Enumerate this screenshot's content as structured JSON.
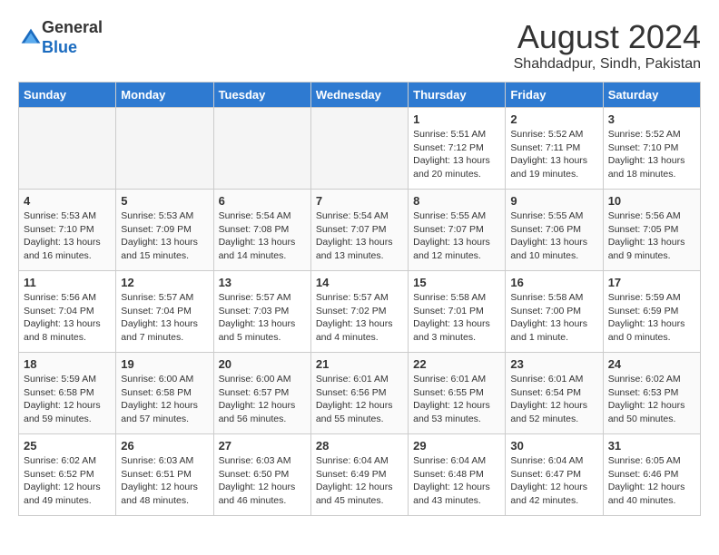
{
  "header": {
    "logo_line1": "General",
    "logo_line2": "Blue",
    "month_year": "August 2024",
    "location": "Shahdadpur, Sindh, Pakistan"
  },
  "days_of_week": [
    "Sunday",
    "Monday",
    "Tuesday",
    "Wednesday",
    "Thursday",
    "Friday",
    "Saturday"
  ],
  "weeks": [
    [
      {
        "day": "",
        "info": ""
      },
      {
        "day": "",
        "info": ""
      },
      {
        "day": "",
        "info": ""
      },
      {
        "day": "",
        "info": ""
      },
      {
        "day": "1",
        "info": "Sunrise: 5:51 AM\nSunset: 7:12 PM\nDaylight: 13 hours\nand 20 minutes."
      },
      {
        "day": "2",
        "info": "Sunrise: 5:52 AM\nSunset: 7:11 PM\nDaylight: 13 hours\nand 19 minutes."
      },
      {
        "day": "3",
        "info": "Sunrise: 5:52 AM\nSunset: 7:10 PM\nDaylight: 13 hours\nand 18 minutes."
      }
    ],
    [
      {
        "day": "4",
        "info": "Sunrise: 5:53 AM\nSunset: 7:10 PM\nDaylight: 13 hours\nand 16 minutes."
      },
      {
        "day": "5",
        "info": "Sunrise: 5:53 AM\nSunset: 7:09 PM\nDaylight: 13 hours\nand 15 minutes."
      },
      {
        "day": "6",
        "info": "Sunrise: 5:54 AM\nSunset: 7:08 PM\nDaylight: 13 hours\nand 14 minutes."
      },
      {
        "day": "7",
        "info": "Sunrise: 5:54 AM\nSunset: 7:07 PM\nDaylight: 13 hours\nand 13 minutes."
      },
      {
        "day": "8",
        "info": "Sunrise: 5:55 AM\nSunset: 7:07 PM\nDaylight: 13 hours\nand 12 minutes."
      },
      {
        "day": "9",
        "info": "Sunrise: 5:55 AM\nSunset: 7:06 PM\nDaylight: 13 hours\nand 10 minutes."
      },
      {
        "day": "10",
        "info": "Sunrise: 5:56 AM\nSunset: 7:05 PM\nDaylight: 13 hours\nand 9 minutes."
      }
    ],
    [
      {
        "day": "11",
        "info": "Sunrise: 5:56 AM\nSunset: 7:04 PM\nDaylight: 13 hours\nand 8 minutes."
      },
      {
        "day": "12",
        "info": "Sunrise: 5:57 AM\nSunset: 7:04 PM\nDaylight: 13 hours\nand 7 minutes."
      },
      {
        "day": "13",
        "info": "Sunrise: 5:57 AM\nSunset: 7:03 PM\nDaylight: 13 hours\nand 5 minutes."
      },
      {
        "day": "14",
        "info": "Sunrise: 5:57 AM\nSunset: 7:02 PM\nDaylight: 13 hours\nand 4 minutes."
      },
      {
        "day": "15",
        "info": "Sunrise: 5:58 AM\nSunset: 7:01 PM\nDaylight: 13 hours\nand 3 minutes."
      },
      {
        "day": "16",
        "info": "Sunrise: 5:58 AM\nSunset: 7:00 PM\nDaylight: 13 hours\nand 1 minute."
      },
      {
        "day": "17",
        "info": "Sunrise: 5:59 AM\nSunset: 6:59 PM\nDaylight: 13 hours\nand 0 minutes."
      }
    ],
    [
      {
        "day": "18",
        "info": "Sunrise: 5:59 AM\nSunset: 6:58 PM\nDaylight: 12 hours\nand 59 minutes."
      },
      {
        "day": "19",
        "info": "Sunrise: 6:00 AM\nSunset: 6:58 PM\nDaylight: 12 hours\nand 57 minutes."
      },
      {
        "day": "20",
        "info": "Sunrise: 6:00 AM\nSunset: 6:57 PM\nDaylight: 12 hours\nand 56 minutes."
      },
      {
        "day": "21",
        "info": "Sunrise: 6:01 AM\nSunset: 6:56 PM\nDaylight: 12 hours\nand 55 minutes."
      },
      {
        "day": "22",
        "info": "Sunrise: 6:01 AM\nSunset: 6:55 PM\nDaylight: 12 hours\nand 53 minutes."
      },
      {
        "day": "23",
        "info": "Sunrise: 6:01 AM\nSunset: 6:54 PM\nDaylight: 12 hours\nand 52 minutes."
      },
      {
        "day": "24",
        "info": "Sunrise: 6:02 AM\nSunset: 6:53 PM\nDaylight: 12 hours\nand 50 minutes."
      }
    ],
    [
      {
        "day": "25",
        "info": "Sunrise: 6:02 AM\nSunset: 6:52 PM\nDaylight: 12 hours\nand 49 minutes."
      },
      {
        "day": "26",
        "info": "Sunrise: 6:03 AM\nSunset: 6:51 PM\nDaylight: 12 hours\nand 48 minutes."
      },
      {
        "day": "27",
        "info": "Sunrise: 6:03 AM\nSunset: 6:50 PM\nDaylight: 12 hours\nand 46 minutes."
      },
      {
        "day": "28",
        "info": "Sunrise: 6:04 AM\nSunset: 6:49 PM\nDaylight: 12 hours\nand 45 minutes."
      },
      {
        "day": "29",
        "info": "Sunrise: 6:04 AM\nSunset: 6:48 PM\nDaylight: 12 hours\nand 43 minutes."
      },
      {
        "day": "30",
        "info": "Sunrise: 6:04 AM\nSunset: 6:47 PM\nDaylight: 12 hours\nand 42 minutes."
      },
      {
        "day": "31",
        "info": "Sunrise: 6:05 AM\nSunset: 6:46 PM\nDaylight: 12 hours\nand 40 minutes."
      }
    ]
  ]
}
